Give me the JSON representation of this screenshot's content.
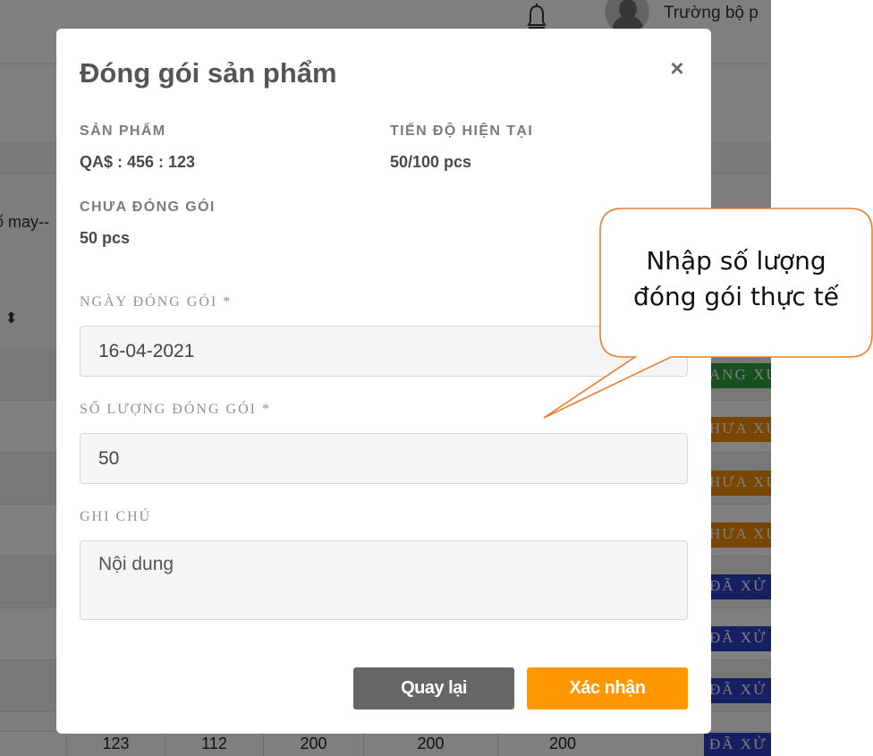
{
  "background_page": {
    "user_name": "Trường bộ p",
    "filter_text": "ố may--",
    "sort_text": ". ⬍",
    "status_badges": [
      "ANG XỬ",
      "HƯA XỬ",
      "HƯA XỬ",
      "HƯA XỬ",
      "ĐÃ XỬ",
      "ĐÃ XỬ",
      "ĐÃ XỬ",
      "ĐÃ XỬ"
    ],
    "bottom_row_cells": [
      "123",
      "112",
      "200",
      "200",
      "200"
    ]
  },
  "modal": {
    "title": "Đóng gói sản phẩm",
    "close_symbol": "×",
    "product_label": "SẢN PHẨM",
    "product_value": "QA$ : 456 : 123",
    "progress_label": "TIẾN ĐỘ HIỆN TẠI",
    "progress_value": "50/100 pcs",
    "unpacked_label": "CHƯA ĐÓNG GÓI",
    "unpacked_value": "50 pcs",
    "pack_date_label": "NGÀY ĐÓNG GÓI *",
    "pack_date_value": "16-04-2021",
    "quantity_label": "SỐ LƯỢNG ĐÓNG GÓI *",
    "quantity_value": "50",
    "note_label": "GHI CHÚ",
    "note_placeholder": "Nội dung",
    "back_button": "Quay lại",
    "confirm_button": "Xác nhận"
  },
  "callout": {
    "line1": "Nhập số lượng",
    "line2": "đóng gói thực tế"
  },
  "colors": {
    "confirm": "#ff9800",
    "back": "#666666",
    "callout_border": "#ed7d31",
    "status_in_progress": "#2e9e3c",
    "status_pending": "#f08c00",
    "status_done": "#2f3fc7"
  },
  "icons": [
    "bell-icon",
    "avatar-icon",
    "close-icon"
  ]
}
